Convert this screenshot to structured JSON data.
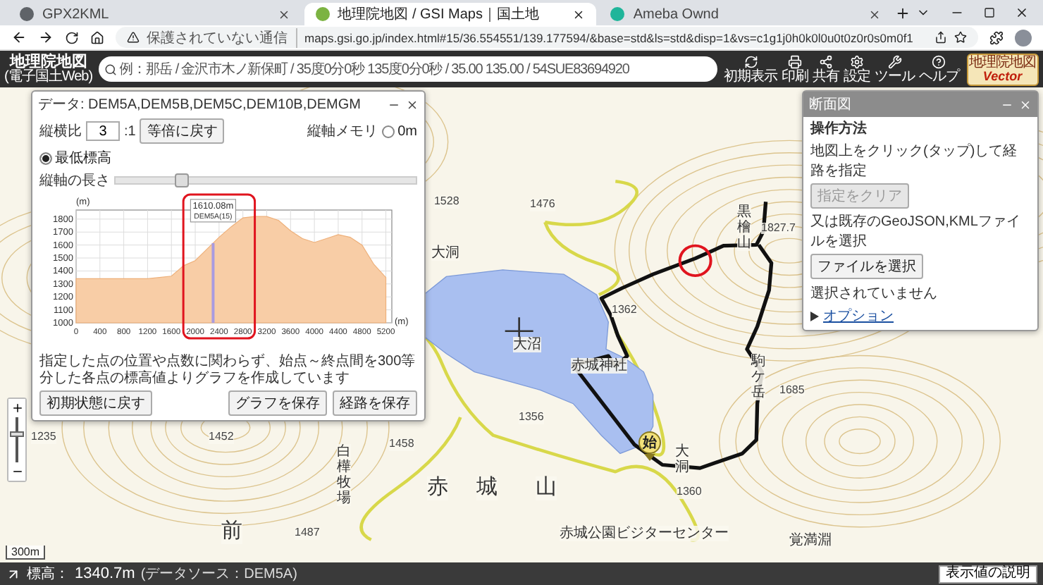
{
  "browser": {
    "tabs": [
      {
        "title": "GPX2KML",
        "selected": false
      },
      {
        "title": "地理院地図 / GSI Maps｜国土地",
        "selected": true
      },
      {
        "title": "Ameba Ownd",
        "selected": false
      }
    ],
    "security": "保護されていない通信",
    "url": "maps.gsi.go.jp/index.html#15/36.554551/139.177594/&base=std&ls=std&disp=1&vs=c1g1j0h0k0l0u0t0z0r0s0m0f1"
  },
  "header": {
    "logo": "地理院地図",
    "logo_sub": "(電子国土Web)",
    "search": {
      "placeholder": "例：那岳 / 金沢市木ノ新保町 / 35度0分0秒 135度0分0秒 / 35.00 135.00 / 54SUE83694920"
    },
    "tools": [
      "初期表示",
      "印刷",
      "共有",
      "設定",
      "ツール",
      "ヘルプ"
    ],
    "badge_top": "地理院地図",
    "badge_bottom": "Vector"
  },
  "profile_panel": {
    "title": "データ: DEM5A,DEM5B,DEM5C,DEM10B,DEMGM",
    "ratio_label": "縦横比",
    "ratio_value": "3",
    "ratio_suffix": ":1",
    "reset_ratio_button": "等倍に戻す",
    "axis_label": "縦軸メモリ",
    "axis_options": [
      {
        "label": "0m",
        "selected": false
      },
      {
        "label": "最低標高",
        "selected": true
      }
    ],
    "length_label": "縦軸の長さ",
    "length_slider": {
      "level": 0.22
    },
    "chart_data": {
      "type": "area",
      "xlabel": "(m)",
      "ylabel": "(m)",
      "x": [
        0,
        200,
        400,
        600,
        800,
        1000,
        1200,
        1400,
        1600,
        1800,
        2000,
        2200,
        2400,
        2600,
        2800,
        3000,
        3200,
        3400,
        3600,
        3800,
        4000,
        4200,
        4400,
        4600,
        4800,
        5000,
        5200
      ],
      "series": [
        {
          "color": "#f8cda6",
          "values": [
            1340,
            1340,
            1340,
            1340,
            1340,
            1340,
            1340,
            1350,
            1360,
            1440,
            1480,
            1570,
            1660,
            1740,
            1810,
            1820,
            1820,
            1790,
            1710,
            1650,
            1620,
            1650,
            1680,
            1660,
            1600,
            1450,
            1350
          ]
        }
      ],
      "xlim": [
        0,
        5300
      ],
      "ylim": [
        1000,
        1870
      ],
      "grid": true,
      "xticks": [
        0,
        400,
        800,
        1200,
        1600,
        2000,
        2400,
        2800,
        3200,
        3600,
        4000,
        4400,
        4800,
        5200
      ],
      "yticks": [
        1000,
        1100,
        1200,
        1300,
        1400,
        1500,
        1600,
        1700,
        1800
      ],
      "ref_lines": [
        {
          "axis": "x",
          "value": 2300,
          "color": "#a99be0"
        }
      ],
      "annotations": [
        "1610.08m",
        "DEM5A(15)"
      ]
    },
    "note": "指定した点の位置や点数に関わらず、始点～終点間を300等分した各点の標高値よりグラフを作成しています",
    "buttons": [
      "初期状態に戻す",
      "グラフを保存",
      "経路を保存"
    ]
  },
  "route_panel": {
    "title": "断面図",
    "heading": "操作方法",
    "instruction": "地図上をクリック(タップ)して経路を指定",
    "clear_button": {
      "label": "指定をクリア",
      "disabled": true
    },
    "file_instruction": "又は既存のGeoJSON,KMLファイルを選択",
    "file_button": {
      "label": "ファイルを選択",
      "disabled": false
    },
    "file_status": "選択されていません",
    "options": {
      "label": "オプション",
      "expanded": false
    }
  },
  "map": {
    "labels": [
      {
        "text": "1528",
        "kind": "elevation"
      },
      {
        "text": "1476",
        "kind": "elevation"
      },
      {
        "text": "黒檜山",
        "kind": "vertical"
      },
      {
        "text": "1827.7",
        "kind": "elevation"
      },
      {
        "text": "大洞",
        "kind": "place"
      },
      {
        "text": "1362",
        "kind": "elevation"
      },
      {
        "text": "大沼",
        "kind": "place"
      },
      {
        "text": "赤城神社",
        "kind": "place"
      },
      {
        "text": "駒ケ岳",
        "kind": "vertical"
      },
      {
        "text": "1685",
        "kind": "elevation"
      },
      {
        "text": "1356",
        "kind": "elevation"
      },
      {
        "text": "1235",
        "kind": "elevation"
      },
      {
        "text": "1452",
        "kind": "elevation"
      },
      {
        "text": "1458",
        "kind": "elevation"
      },
      {
        "text": "白樺牧場",
        "kind": "vertical"
      },
      {
        "text": "大洞",
        "kind": "vertical"
      },
      {
        "text": "赤",
        "kind": "big"
      },
      {
        "text": "城",
        "kind": "big"
      },
      {
        "text": "山",
        "kind": "big"
      },
      {
        "text": "1360",
        "kind": "elevation"
      },
      {
        "text": "前",
        "kind": "big"
      },
      {
        "text": "1487",
        "kind": "elevation"
      },
      {
        "text": "赤城公園ビジターセンター",
        "kind": "place"
      },
      {
        "text": "覚満淵",
        "kind": "place"
      }
    ],
    "start_marker": "始",
    "scale": "300m"
  },
  "status_bar": {
    "elevation_label": "標高：",
    "elevation": "1340.7m",
    "source": "(データソース：DEM5A)",
    "help_button": "表示値の説明"
  }
}
